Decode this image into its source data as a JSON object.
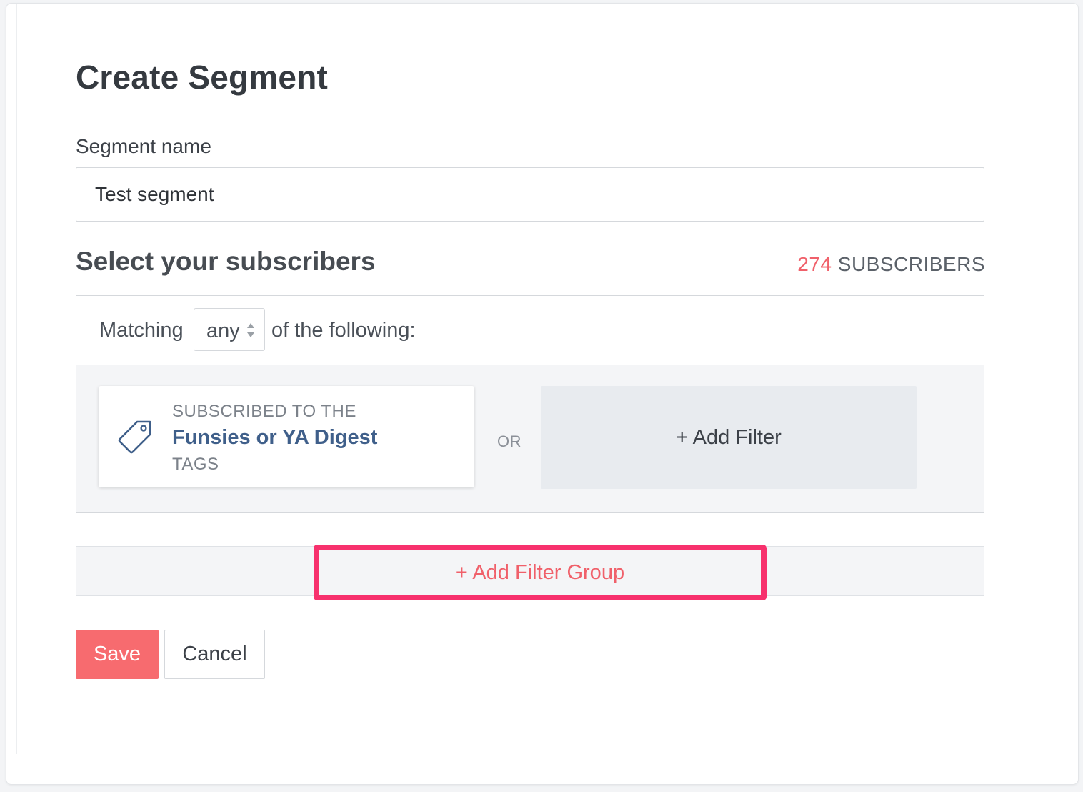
{
  "modal": {
    "title": "Create Segment"
  },
  "segment_name": {
    "label": "Segment name",
    "value": "Test segment"
  },
  "subscribers": {
    "title": "Select your subscribers",
    "count": "274",
    "count_label": "SUBSCRIBERS",
    "count_color": "#f0606a"
  },
  "matching": {
    "prefix": "Matching",
    "selected": "any",
    "suffix": "of the following:"
  },
  "filter_card": {
    "icon": "tag-icon",
    "line1": "SUBSCRIBED TO THE",
    "line2": "Funsies or YA Digest",
    "line3": "TAGS"
  },
  "or_label": "OR",
  "add_filter_label": "+ Add Filter",
  "add_filter_group_label": "+ Add Filter Group",
  "highlight_color": "#f7316d",
  "actions": {
    "save_label": "Save",
    "cancel_label": "Cancel",
    "save_color": "#f76b6f"
  }
}
